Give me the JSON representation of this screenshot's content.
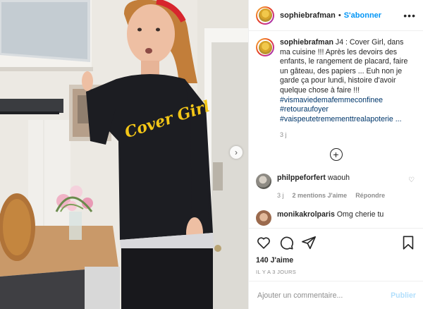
{
  "post": {
    "author": "sophiebrafman",
    "follow_label": "S'abonner",
    "more_label": "•••",
    "next_label": "›"
  },
  "caption": {
    "username": "sophiebrafman",
    "text": "J4 : Cover Girl, dans ma cuisine !!! Après les devoirs des enfants, le rangement de placard, faire un gâteau, des papiers ... Euh non je garde ça pour lundi, histoire d'avoir quelque chose à faire !!!",
    "hashtags": [
      "#vismaviedemafemmeconfinee",
      "#retouraufoyer",
      "#vaispeutetremementtrealapoterie ..."
    ],
    "age": "3 j"
  },
  "load_more_label": "+",
  "comments": [
    {
      "username": "philppeforfert",
      "text": "waouh",
      "age": "3 j",
      "likes": "2 mentions J'aime",
      "reply_label": "Répondre"
    },
    {
      "username": "monikakrolparis",
      "text": "Omg cherie tu"
    }
  ],
  "stats": {
    "likes": "140 J'aime",
    "date": "IL Y A 3 JOURS"
  },
  "composer": {
    "placeholder": "Ajouter un commentaire...",
    "publish_label": "Publier"
  },
  "photo": {
    "sweater_text": "Cover Girl"
  },
  "colors": {
    "accent": "#0095f6",
    "publish_disabled": "#b2dffc",
    "hashtag": "#00376b",
    "muted": "#8e8e8e",
    "border": "#efefef"
  },
  "icons": [
    "heart-icon",
    "comment-icon",
    "share-icon",
    "bookmark-icon",
    "plus-circle-icon",
    "more-icon",
    "chevron-right-icon"
  ]
}
